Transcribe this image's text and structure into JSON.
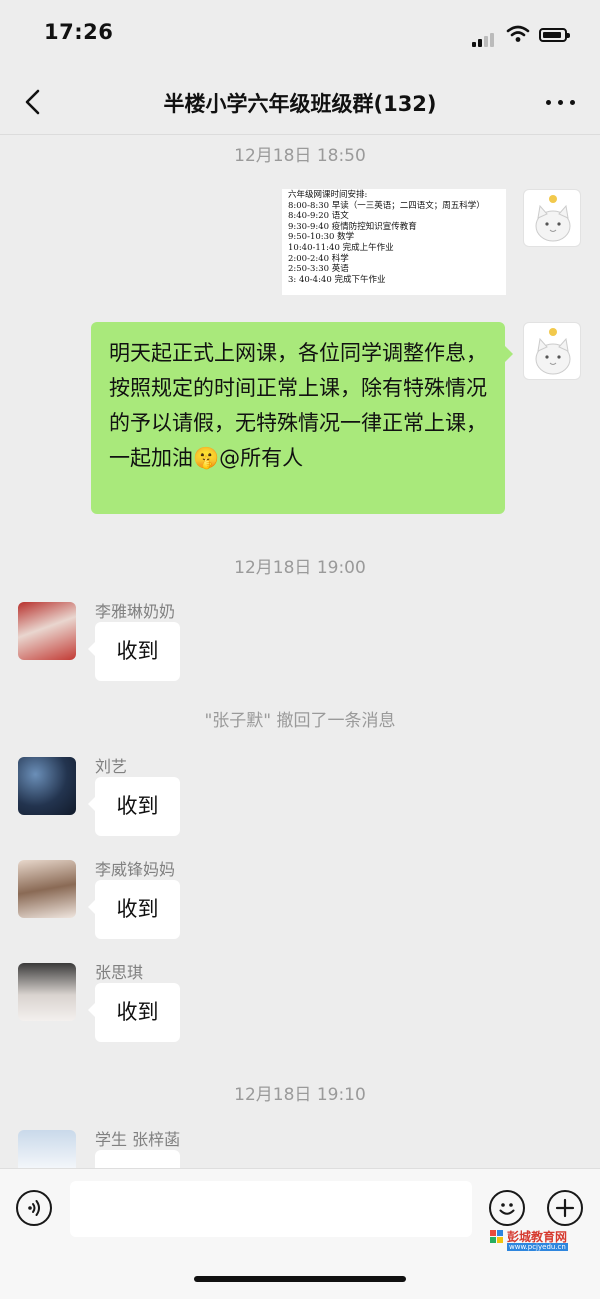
{
  "status_bar": {
    "time": "17:26"
  },
  "header": {
    "title": "半楼小学六年级班级群(132)",
    "back_icon": "chevron-left-icon",
    "more_icon": "ellipsis-icon"
  },
  "messages": {
    "ts1": "12月18日 18:50",
    "schedule_image": {
      "lines": [
        "六年级网课时间安排:",
        "8:00-8:30  早读（一三英语；二四语文；周五科学）",
        "8:40-9:20  语文",
        "9:30-9:40  疫情防控知识宣传教育",
        "9:50-10:30  数学",
        "10:40-11:40 完成上午作业",
        "2:00-2:40  科学",
        "2:50-3:30  英语",
        "3: 40-4:40 完成下午作业"
      ]
    },
    "announcement": "明天起正式上网课，各位同学调整作息，按照规定的时间正常上课，除有特殊情况的予以请假，无特殊情况一律正常上课，一起加油🤫@所有人",
    "ts2": "12月18日 19:00",
    "m1": {
      "name": "李雅琳奶奶",
      "text": "收到"
    },
    "recall": "\"张子默\" 撤回了一条消息",
    "m2": {
      "name": "刘艺",
      "text": "收到"
    },
    "m3": {
      "name": "李威锋妈妈",
      "text": "收到"
    },
    "m4": {
      "name": "张思琪",
      "text": "收到"
    },
    "ts3": "12月18日 19:10",
    "m5": {
      "name": "学生 张梓菡"
    }
  },
  "input_bar": {
    "voice_icon": "voice-icon",
    "emoji_icon": "emoji-icon",
    "plus_icon": "plus-icon"
  },
  "watermark": {
    "brand": "彭城教育网",
    "url": "www.pcjyedu.cn"
  },
  "colors": {
    "background": "#ededed",
    "my_bubble": "#a9e97b",
    "timestamp": "#9a9a9a"
  }
}
